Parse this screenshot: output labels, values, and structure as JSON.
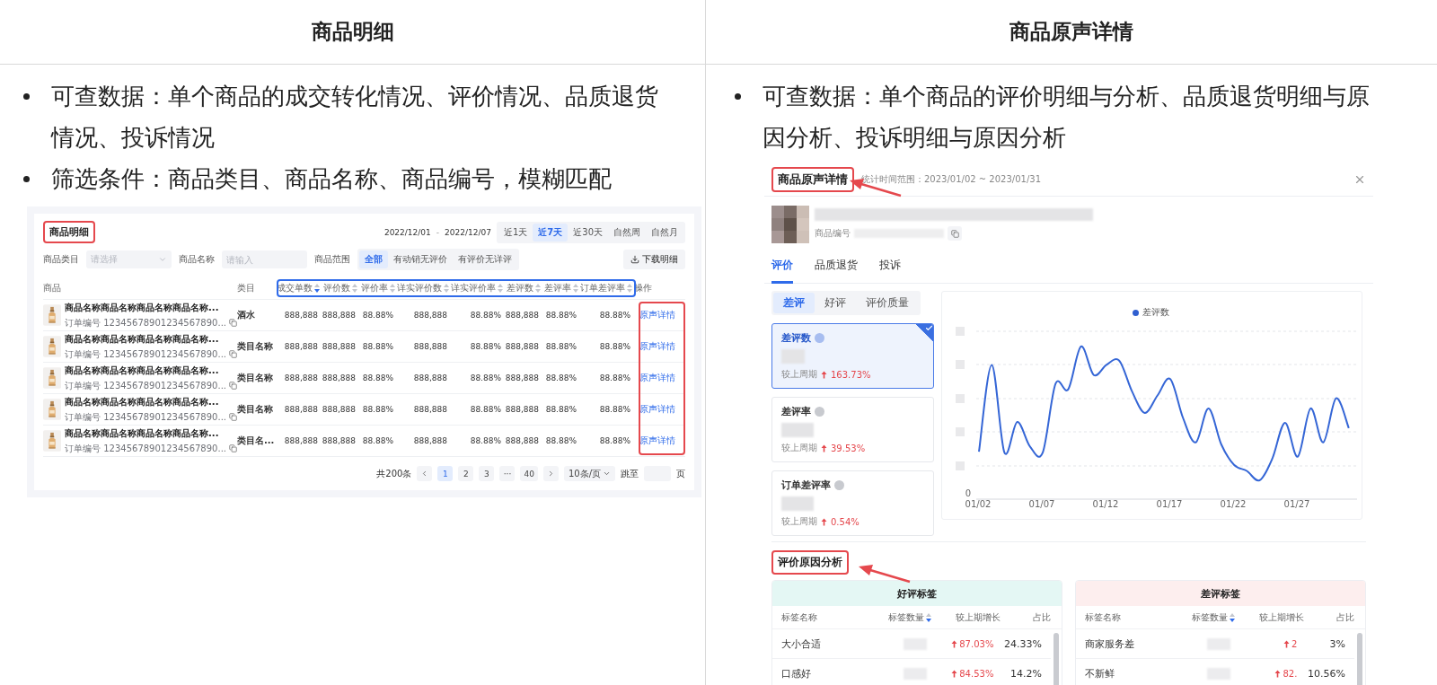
{
  "left_column": {
    "heading": "商品明细",
    "bullets": [
      "可查数据：单个商品的成交转化情况、评价情况、品质退货情况、投诉情况",
      "筛选条件：商品类目、商品名称、商品编号，模糊匹配"
    ],
    "product_detail": {
      "title": "商品明细",
      "date_start": "2022/12/01",
      "date_separator": "-",
      "date_end": "2022/12/07",
      "ranges": [
        {
          "label": "近1天",
          "selected": false
        },
        {
          "label": "近7天",
          "selected": true
        },
        {
          "label": "近30天",
          "selected": false
        },
        {
          "label": "自然周",
          "selected": false
        },
        {
          "label": "自然月",
          "selected": false
        }
      ],
      "category_filter": {
        "label": "商品类目",
        "placeholder": "请选择"
      },
      "name_filter": {
        "label": "商品名称",
        "placeholder": "请输入"
      },
      "scope_label": "商品范围",
      "scopes": [
        {
          "label": "全部",
          "selected": true
        },
        {
          "label": "有动销无评价",
          "selected": false
        },
        {
          "label": "有评价无详评",
          "selected": false
        }
      ],
      "download_button": "下载明细",
      "columns": [
        {
          "label": "商品",
          "kind": "plain"
        },
        {
          "label": "类目",
          "kind": "plain"
        },
        {
          "label": "成交单数",
          "kind": "sortable",
          "sorted": true
        },
        {
          "label": "评价数",
          "kind": "sortable",
          "sorted": false
        },
        {
          "label": "评价率",
          "kind": "sortable",
          "sorted": false
        },
        {
          "label": "详实评价数",
          "kind": "sortable",
          "sorted": false
        },
        {
          "label": "详实评价率",
          "kind": "sortable",
          "sorted": false
        },
        {
          "label": "差评数",
          "kind": "sortable",
          "sorted": false
        },
        {
          "label": "差评率",
          "kind": "sortable",
          "sorted": false
        },
        {
          "label": "订单差评率",
          "kind": "sortable",
          "sorted": false
        },
        {
          "label": "操作",
          "kind": "plain"
        }
      ],
      "rows": [
        {
          "name": "商品名称商品名称商品名称商品名称...",
          "order_no": "订单编号 12345678901234567890...",
          "category": "酒水",
          "values": [
            "888,888",
            "888,888",
            "88.88%",
            "888,888",
            "88.88%",
            "888,888",
            "88.88%",
            "88.88%"
          ],
          "action": "原声详情"
        },
        {
          "name": "商品名称商品名称商品名称商品名称...",
          "order_no": "订单编号 12345678901234567890...",
          "category": "类目名称",
          "values": [
            "888,888",
            "888,888",
            "88.88%",
            "888,888",
            "88.88%",
            "888,888",
            "88.88%",
            "88.88%"
          ],
          "action": "原声详情"
        },
        {
          "name": "商品名称商品名称商品名称商品名称...",
          "order_no": "订单编号 12345678901234567890...",
          "category": "类目名称",
          "values": [
            "888,888",
            "888,888",
            "88.88%",
            "888,888",
            "88.88%",
            "888,888",
            "88.88%",
            "88.88%"
          ],
          "action": "原声详情"
        },
        {
          "name": "商品名称商品名称商品名称商品名称...",
          "order_no": "订单编号 12345678901234567890...",
          "category": "类目名称",
          "values": [
            "888,888",
            "888,888",
            "88.88%",
            "888,888",
            "88.88%",
            "888,888",
            "88.88%",
            "88.88%"
          ],
          "action": "原声详情"
        },
        {
          "name": "商品名称商品名称商品名称商品名称...",
          "order_no": "订单编号 12345678901234567890...",
          "category": "类目名...",
          "values": [
            "888,888",
            "888,888",
            "88.88%",
            "888,888",
            "88.88%",
            "888,888",
            "88.88%",
            "88.88%"
          ],
          "action": "原声详情"
        }
      ],
      "pagination": {
        "total": "共200条",
        "pages": [
          {
            "label": "1",
            "selected": true
          },
          {
            "label": "2",
            "selected": false
          },
          {
            "label": "3",
            "selected": false
          },
          {
            "label": "···",
            "selected": false
          },
          {
            "label": "40",
            "selected": false
          }
        ],
        "page_size": "10条/页",
        "jump_label": "跳至",
        "jump_suffix": "页"
      }
    }
  },
  "right_column": {
    "heading": "商品原声详情",
    "bullets": [
      "可查数据：单个商品的评价明细与分析、品质退货明细与原因分析、投诉明细与原因分析"
    ],
    "voice_detail": {
      "title": "商品原声详情",
      "time_range": "统计时间范围：2023/01/02 ~ 2023/01/31",
      "product_no_label": "商品编号",
      "tabs": [
        {
          "label": "评价",
          "selected": true
        },
        {
          "label": "品质退货",
          "selected": false
        },
        {
          "label": "投诉",
          "selected": false
        }
      ],
      "segments": [
        {
          "label": "差评",
          "selected": true
        },
        {
          "label": "好评",
          "selected": false
        },
        {
          "label": "评价质量",
          "selected": false
        }
      ],
      "metrics": [
        {
          "name": "差评数",
          "selected": true,
          "compare_label": "较上周期",
          "change": "163.73%"
        },
        {
          "name": "差评率",
          "selected": false,
          "compare_label": "较上周期",
          "change": "39.53%"
        },
        {
          "name": "订单差评率",
          "selected": false,
          "compare_label": "较上周期",
          "change": "0.54%"
        }
      ],
      "chart": {
        "legend": "差评数",
        "y_tick": "0",
        "x_ticks": [
          "01/02",
          "01/07",
          "01/12",
          "01/17",
          "01/22",
          "01/27"
        ]
      },
      "section_title": "评价原因分析",
      "tag_tables": [
        {
          "title": "好评标签",
          "color": "#e4f7f4",
          "columns": [
            {
              "label": "标签名称",
              "kind": "plain"
            },
            {
              "label": "标签数量",
              "kind": "sortable",
              "sorted": true
            },
            {
              "label": "较上期增长",
              "kind": "plain"
            },
            {
              "label": "占比",
              "kind": "plain"
            }
          ],
          "rows": [
            {
              "name": "大小合适",
              "growth": "87.03%",
              "share": "24.33%"
            },
            {
              "name": "口感好",
              "growth": "84.53%",
              "share": "14.2%"
            }
          ]
        },
        {
          "title": "差评标签",
          "color": "#fdeeee",
          "columns": [
            {
              "label": "标签名称",
              "kind": "plain"
            },
            {
              "label": "标签数量",
              "kind": "sortable",
              "sorted": true
            },
            {
              "label": "较上期增长",
              "kind": "plain"
            },
            {
              "label": "占比",
              "kind": "plain"
            }
          ],
          "rows": [
            {
              "name": "商家服务差",
              "growth": "2",
              "share": "3%"
            },
            {
              "name": "不新鲜",
              "growth": "82.",
              "share": "10.56%"
            }
          ]
        }
      ]
    }
  }
}
